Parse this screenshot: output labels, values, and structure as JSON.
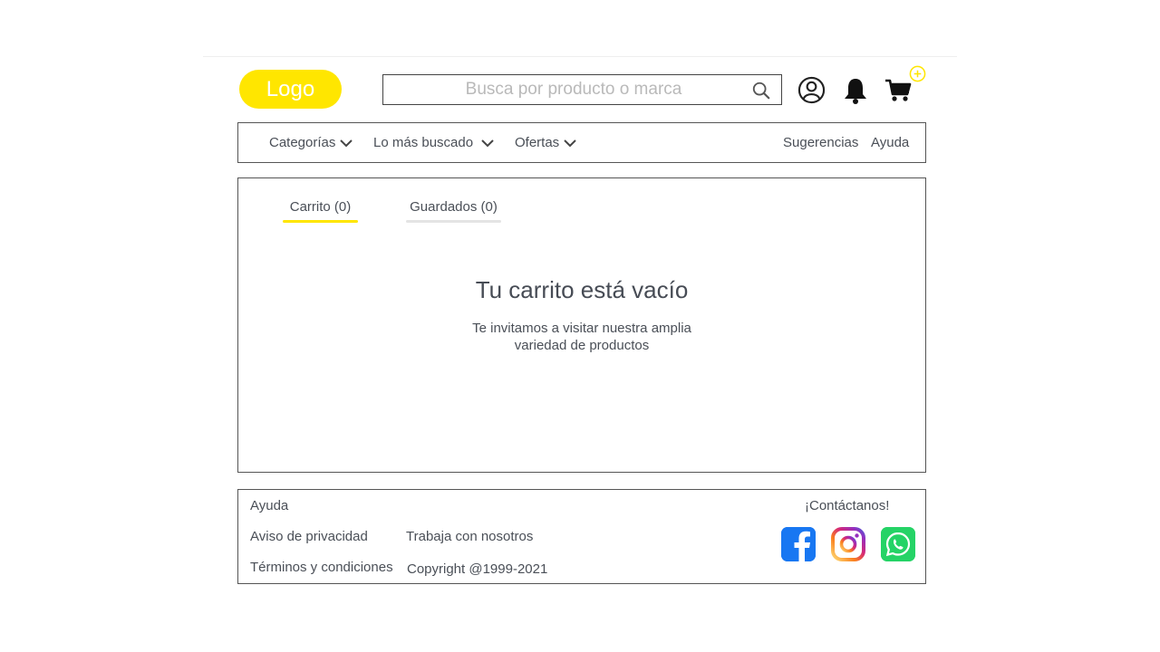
{
  "header": {
    "logo_text": "Logo",
    "search_placeholder": "Busca por producto o marca",
    "search_value": ""
  },
  "nav": {
    "items": [
      {
        "label": "Categorías",
        "icon": "chevron-down-icon"
      },
      {
        "label": "Lo más buscado",
        "icon": "chevron-down-icon"
      },
      {
        "label": "Ofertas",
        "icon": "chevron-down-icon"
      }
    ],
    "right_items": [
      "Sugerencias",
      "Ayuda"
    ]
  },
  "tabs": [
    {
      "label": "Carrito (0)",
      "active": true
    },
    {
      "label": "Guardados (0)",
      "active": false
    }
  ],
  "empty_state": {
    "title": "Tu carrito está vacío",
    "line1": "Te invitamos a visitar nuestra amplia",
    "line2": "variedad de productos"
  },
  "footer": {
    "links_col1": [
      "Ayuda",
      "Aviso de privacidad",
      "Términos y condiciones"
    ],
    "links_col2": [
      "Trabaja con nosotros"
    ],
    "copyright": "Copyright @1999-2021",
    "contact_label": "¡Contáctanos!",
    "social": [
      "facebook-icon",
      "instagram-icon",
      "whatsapp-icon"
    ]
  },
  "colors": {
    "accent": "#ffe600",
    "text": "#4a4f57",
    "facebook": "#1877f2",
    "whatsapp": "#25d366"
  }
}
